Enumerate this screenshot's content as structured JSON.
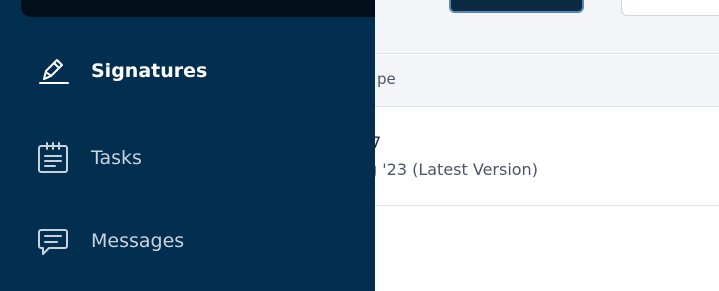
{
  "background": {
    "table_header": {
      "partial_column_label": "pe"
    },
    "row": {
      "partial_title": "7",
      "partial_subtitle": "g '23 (Latest Version)"
    }
  },
  "drawer": {
    "items": [
      {
        "label": "Signatures",
        "icon": "signature-pen-icon",
        "active": true
      },
      {
        "label": "Tasks",
        "icon": "clipboard-icon",
        "active": false
      },
      {
        "label": "Messages",
        "icon": "chat-bubble-icon",
        "active": false
      }
    ]
  },
  "colors": {
    "drawer_bg": "#022f4f",
    "drawer_topbar": "#020f1a",
    "active_text": "#ffffff",
    "inactive_text": "#c9d3de"
  }
}
